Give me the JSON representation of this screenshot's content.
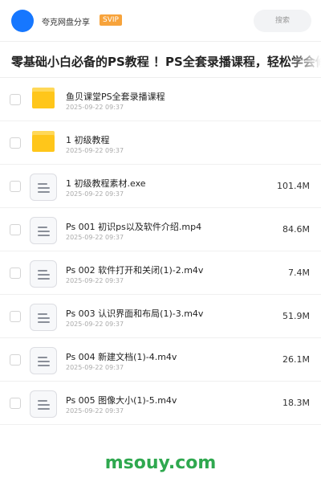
{
  "header": {
    "account_name": "夸克网盘分享",
    "badge": "SVIP",
    "search_placeholder": "搜索"
  },
  "share_title": "零基础小白必备的PS教程 ！PS全套录播课程，轻松学会修图",
  "files": [
    {
      "type": "folder",
      "name": "鱼贝课堂PS全套录播课程",
      "date": "2025-09-22 09:37",
      "size": ""
    },
    {
      "type": "folder",
      "name": "1 初级教程",
      "date": "2025-09-22 09:37",
      "size": ""
    },
    {
      "type": "file",
      "name": "1 初级教程素材.exe",
      "date": "2025-09-22 09:37",
      "size": "101.4M"
    },
    {
      "type": "file",
      "name": "Ps 001 初识ps以及软件介绍.mp4",
      "date": "2025-09-22 09:37",
      "size": "84.6M"
    },
    {
      "type": "file",
      "name": "Ps 002 软件打开和关闭(1)-2.m4v",
      "date": "2025-09-22 09:37",
      "size": "7.4M"
    },
    {
      "type": "file",
      "name": "Ps 003 认识界面和布局(1)-3.m4v",
      "date": "2025-09-22 09:37",
      "size": "51.9M"
    },
    {
      "type": "file",
      "name": "Ps 004 新建文档(1)-4.m4v",
      "date": "2025-09-22 09:37",
      "size": "26.1M"
    },
    {
      "type": "file",
      "name": "Ps 005 图像大小(1)-5.m4v",
      "date": "2025-09-22 09:37",
      "size": "18.3M"
    }
  ],
  "watermark": "msouy.com",
  "colors": {
    "accent": "#1677ff",
    "svip_badge": "#f7a33b",
    "folder": "#ffc61a",
    "watermark": "#2fa84f"
  }
}
